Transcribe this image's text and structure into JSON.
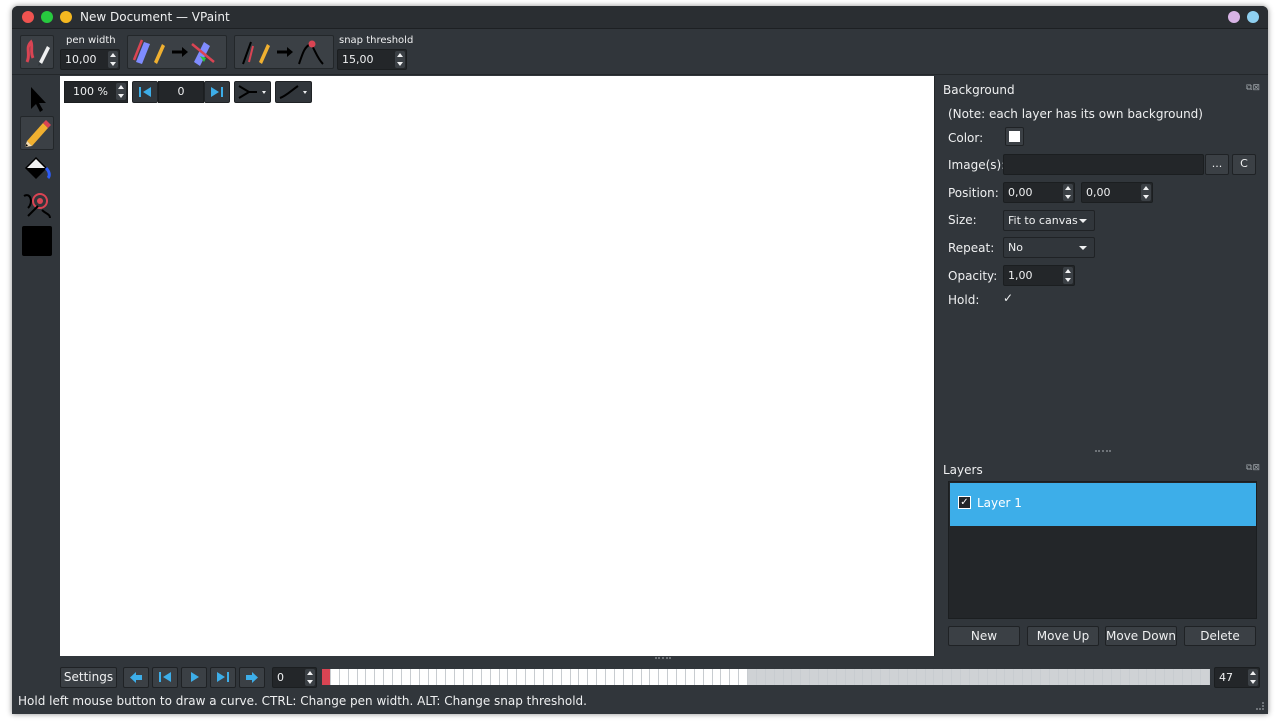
{
  "window": {
    "title": "New Document — VPaint",
    "traffic_colors": [
      "#ef5350",
      "#27c93f",
      "#f5b820"
    ],
    "right_dots": [
      "#d8b4e6",
      "#8fd0f0"
    ]
  },
  "toolbar": {
    "pen_width_label": "pen width",
    "pen_width_value": "10,00",
    "snap_threshold_label": "snap threshold",
    "snap_threshold_value": "15,00"
  },
  "canvas_toolbar": {
    "zoom": "100 %",
    "frame": "0"
  },
  "background_panel": {
    "title": "Background",
    "note": "(Note: each layer has its own background)",
    "color_label": "Color:",
    "color_value": "#ffffff",
    "images_label": "Image(s):",
    "images_value": "",
    "browse_label": "...",
    "refresh_label": "C",
    "position_label": "Position:",
    "position_x": "0,00",
    "position_y": "0,00",
    "size_label": "Size:",
    "size_value": "Fit to canvas",
    "repeat_label": "Repeat:",
    "repeat_value": "No",
    "opacity_label": "Opacity:",
    "opacity_value": "1,00",
    "hold_label": "Hold:",
    "hold_checked": "✓"
  },
  "layers_panel": {
    "title": "Layers",
    "layers": [
      {
        "name": "Layer 1",
        "checked": "✓"
      }
    ],
    "new_label": "New",
    "move_up_label": "Move Up",
    "move_down_label": "Move Down",
    "delete_label": "Delete"
  },
  "timeline": {
    "settings_label": "Settings",
    "current_frame": "0",
    "last_frame": "47",
    "accent": "#da4453"
  },
  "status": {
    "text": "Hold left mouse button to draw a curve. CTRL: Change pen width. ALT: Change snap threshold."
  },
  "panel_icons": "⧉⊠"
}
